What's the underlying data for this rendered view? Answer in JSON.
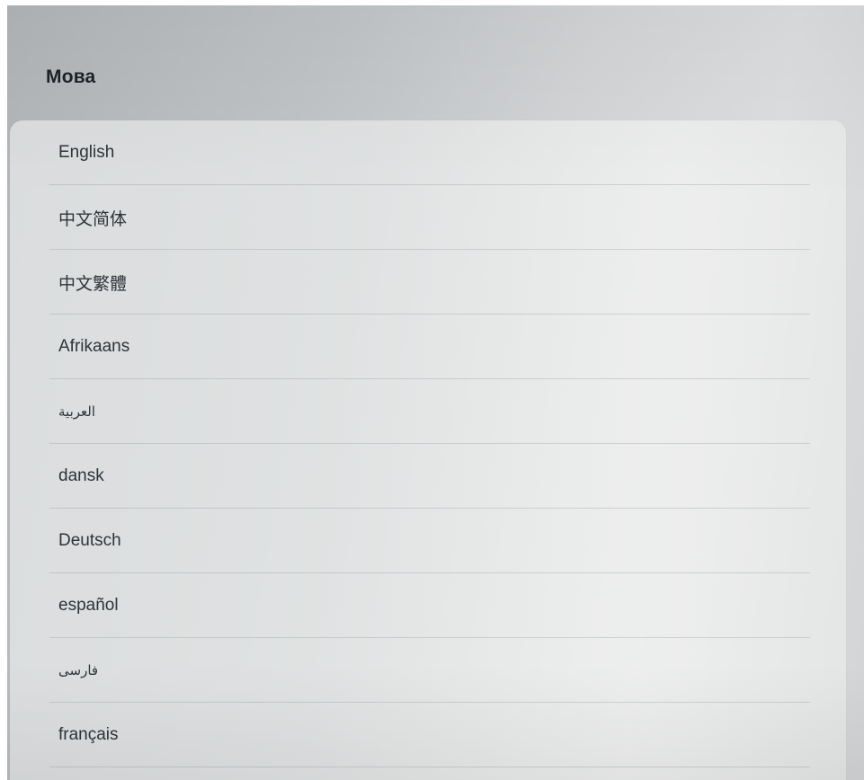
{
  "header": {
    "title": "Мова"
  },
  "languages": [
    {
      "label": "English"
    },
    {
      "label": "中文简体"
    },
    {
      "label": "中文繁體"
    },
    {
      "label": "Afrikaans"
    },
    {
      "label": "العربية"
    },
    {
      "label": "dansk"
    },
    {
      "label": "Deutsch"
    },
    {
      "label": "español"
    },
    {
      "label": "فارسی"
    },
    {
      "label": "français"
    }
  ]
}
